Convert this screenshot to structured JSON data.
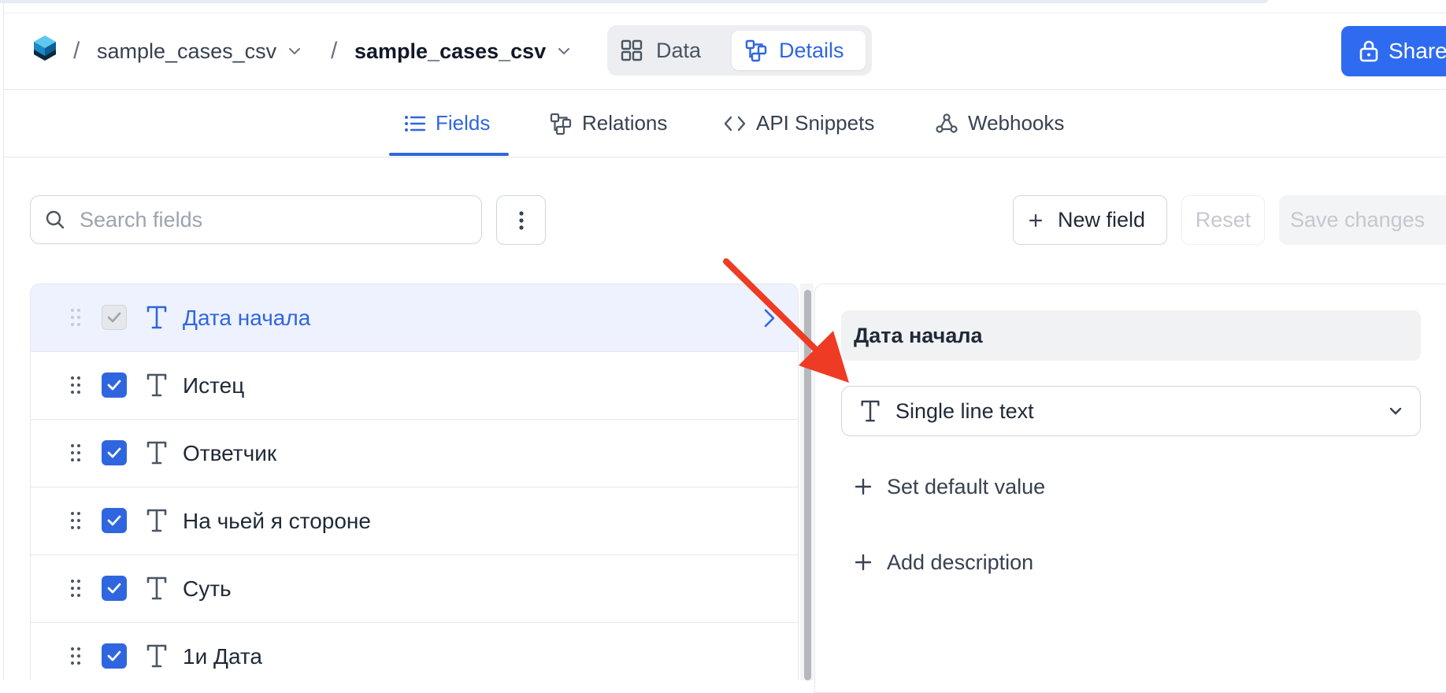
{
  "header": {
    "breadcrumb": [
      "sample_cases_csv",
      "sample_cases_csv"
    ],
    "separator": "/",
    "view_toggle": [
      "Data",
      "Details"
    ],
    "share_label": "Share"
  },
  "tabs": [
    "Fields",
    "Relations",
    "API Snippets",
    "Webhooks"
  ],
  "toolbar": {
    "search_placeholder": "Search fields",
    "new_field_label": "New field",
    "reset_label": "Reset",
    "save_label": "Save changes"
  },
  "fields": [
    {
      "name": "Дата начала",
      "checked": true,
      "selected": true
    },
    {
      "name": "Истец",
      "checked": true,
      "selected": false
    },
    {
      "name": "Ответчик",
      "checked": true,
      "selected": false
    },
    {
      "name": "На чьей я стороне",
      "checked": true,
      "selected": false
    },
    {
      "name": "Суть",
      "checked": true,
      "selected": false
    },
    {
      "name": "1и Дата",
      "checked": true,
      "selected": false
    }
  ],
  "detail": {
    "field_name": "Дата начала",
    "field_type": "Single line text",
    "set_default_label": "Set default value",
    "add_description_label": "Add description"
  },
  "colors": {
    "accent": "#2f66e0",
    "share_button": "#2f6bf0",
    "annotation_arrow": "#ee3b24",
    "selected_row": "#eef2fe"
  }
}
